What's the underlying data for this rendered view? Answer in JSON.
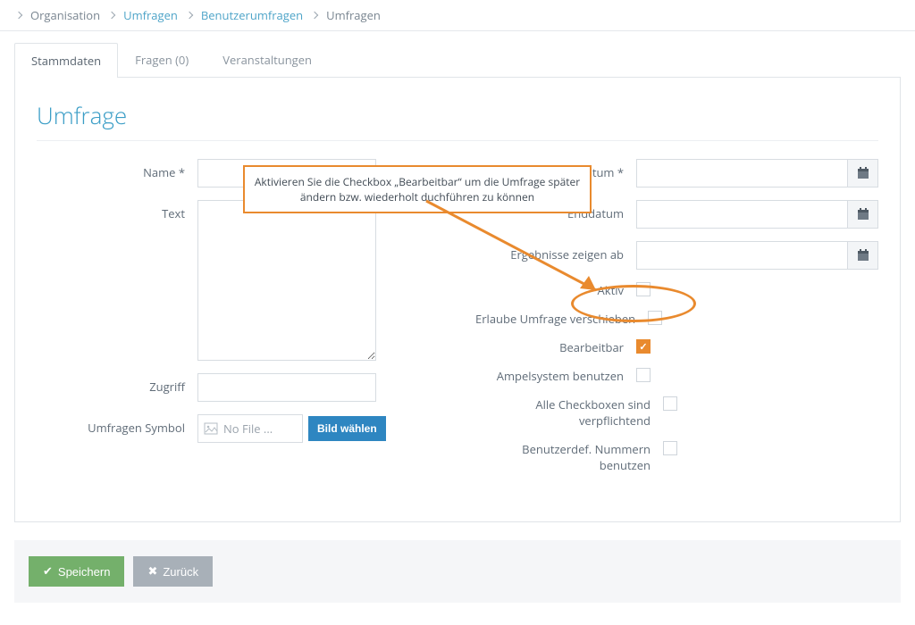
{
  "breadcrumb": {
    "items": [
      "Organisation",
      "Umfragen",
      "Benutzerumfragen",
      "Umfragen"
    ]
  },
  "tabs": [
    {
      "label": "Stammdaten",
      "active": true
    },
    {
      "label": "Fragen (0)"
    },
    {
      "label": "Veranstaltungen"
    }
  ],
  "page_title": "Umfrage",
  "left": {
    "name": {
      "label": "Name *",
      "value": ""
    },
    "text": {
      "label": "Text",
      "value": ""
    },
    "access": {
      "label": "Zugriff",
      "value": ""
    },
    "symbol": {
      "label": "Umfragen Symbol",
      "file_text": "No File ...",
      "choose_label": "Bild wählen"
    }
  },
  "right": {
    "start": {
      "label": "Startdatum *",
      "value": ""
    },
    "end": {
      "label": "Enddatum",
      "value": ""
    },
    "show_from": {
      "label": "Ergebnisse zeigen ab",
      "value": ""
    },
    "active": {
      "label": "Aktiv",
      "checked": false
    },
    "movable": {
      "label": "Erlaube Umfrage verschieben",
      "checked": false
    },
    "editable": {
      "label": "Bearbeitbar",
      "checked": true
    },
    "traffic": {
      "label": "Ampelsystem benutzen",
      "checked": false
    },
    "all_required": {
      "label": "Alle Checkboxen sind verpflichtend",
      "checked": false
    },
    "user_numbers": {
      "label": "Benutzerdef. Nummern benutzen",
      "checked": false
    }
  },
  "annotation": {
    "text": "Aktivieren Sie die Checkbox „Bearbeitbar“ um die Umfrage später ändern bzw. wiederholt duchführen zu können"
  },
  "actions": {
    "save": "Speichern",
    "back": "Zurück"
  }
}
